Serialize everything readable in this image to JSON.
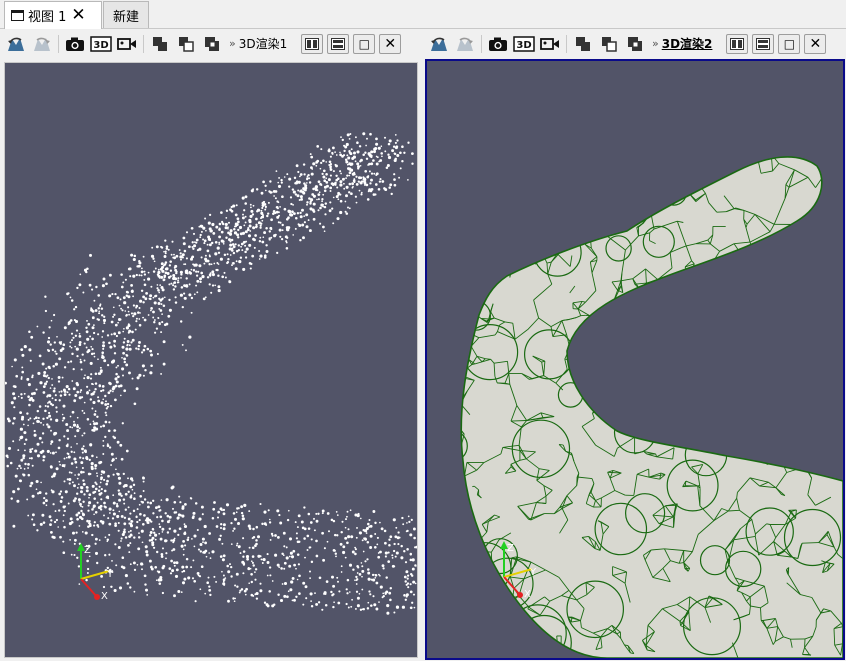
{
  "tabs": [
    {
      "label": "视图 1",
      "active": true,
      "closable": true
    },
    {
      "label": "新建",
      "active": false,
      "closable": false
    }
  ],
  "views": [
    {
      "title": "3D渲染1",
      "active": false,
      "toolbar_icons": [
        "reset-camera-icon",
        "redo-camera-icon",
        "screenshot-camera-icon",
        "3d-mode-icon",
        "video-camera-icon",
        "interact-select-icon",
        "select-copy-icon",
        "select-overlay-icon"
      ],
      "layout_buttons": [
        "split-horizontal-icon",
        "split-vertical-icon",
        "maximize-icon",
        "close-icon"
      ],
      "render_mode": "points",
      "axes": {
        "x": "X",
        "y": "Y",
        "z": "Z"
      }
    },
    {
      "title": "3D渲染2",
      "active": true,
      "toolbar_icons": [
        "reset-camera-icon",
        "redo-camera-icon",
        "screenshot-camera-icon",
        "3d-mode-icon",
        "video-camera-icon",
        "interact-select-icon",
        "select-copy-icon",
        "select-overlay-icon"
      ],
      "layout_buttons": [
        "split-horizontal-icon",
        "split-vertical-icon",
        "maximize-icon",
        "close-icon"
      ],
      "render_mode": "wireframe-surface",
      "axes": {
        "x": "X",
        "y": "Y",
        "z": "Z"
      }
    }
  ],
  "glyphs": {
    "chevron": "»",
    "close": "✕",
    "maximize": "□",
    "tab_close": "✕"
  },
  "colors": {
    "viewport_bg": "#525468",
    "point_color": "#ffffff",
    "mesh_fill": "#d8d8d0",
    "mesh_edge": "#1a6a12",
    "active_border": "#0a0a8a",
    "axis_x": "#e52222",
    "axis_y": "#e5d000",
    "axis_z": "#22d022"
  }
}
